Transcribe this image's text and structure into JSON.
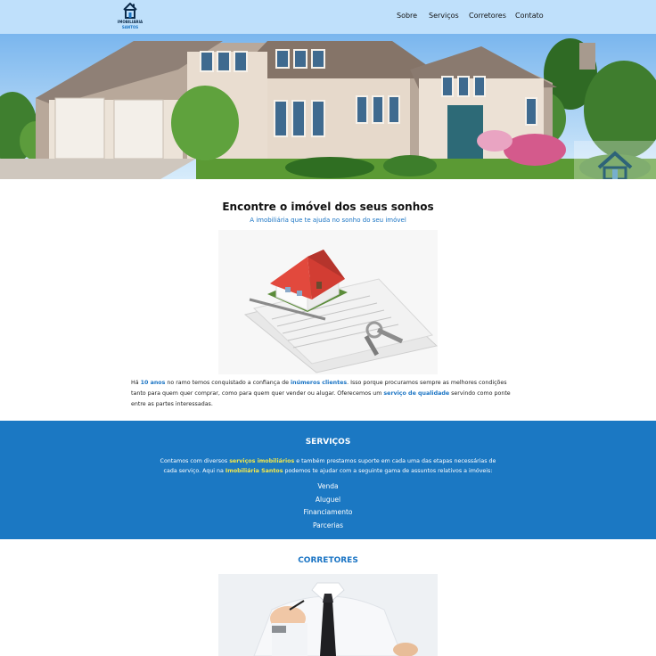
{
  "brand": {
    "name": "IMOBILIÁRIA",
    "sub": "SANTOS",
    "color_primary": "#1b78c3",
    "color_header": "#bfe0fb",
    "color_highlight": "#f3e84b"
  },
  "nav": {
    "items": [
      {
        "label": "Sobre"
      },
      {
        "label": "Serviços"
      },
      {
        "label": "Corretores"
      },
      {
        "label": "Contato"
      }
    ]
  },
  "intro": {
    "title": "Encontre o imóvel dos seus sonhos",
    "subtitle": "A imobiliária que te ajuda no sonho do seu imóvel",
    "p1": "Há ",
    "b1": "10 anos",
    "p2": " no ramo temos conquistado a confiança de ",
    "b2": "inúmeros clientes",
    "p3": ". Isso porque procuramos sempre as melhores condições tanto para quem quer comprar, como para quem quer vender ou alugar. Oferecemos um ",
    "b3": "serviço de qualidade",
    "p4": " servindo como ponte entre as partes interessadas."
  },
  "services": {
    "title": "SERVIÇOS",
    "t1": "Contamos com diversos ",
    "h1": "serviços imobiliários",
    "t2": " e também prestamos suporte em cada uma das etapas necessárias de cada serviço. Aqui na ",
    "h2": "Imobiliária Santos",
    "t3": " podemos te ajudar com a seguinte gama de assuntos relativos a imóveis:",
    "items": [
      "Venda",
      "Aluguel",
      "Financiamento",
      "Parcerias"
    ]
  },
  "brokers": {
    "title": "CORRETORES"
  },
  "icons": {
    "logo": "house-logo-icon",
    "hero_watermark": "house-watermark-icon"
  }
}
